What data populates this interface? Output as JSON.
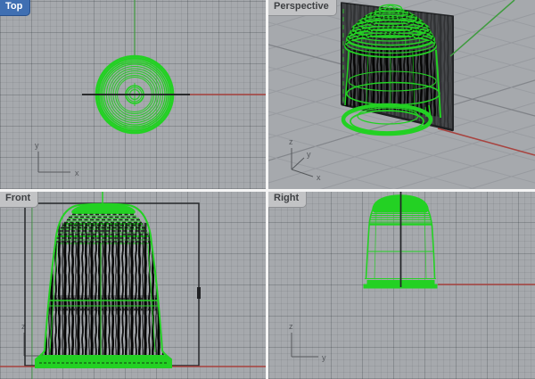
{
  "viewports": [
    {
      "id": "top",
      "label": "Top",
      "active": true,
      "axis_h": "x",
      "axis_v": "y"
    },
    {
      "id": "perspective",
      "label": "Perspective",
      "active": false,
      "axis_h": "x",
      "axis_v": "z",
      "axis_d": "y"
    },
    {
      "id": "front",
      "label": "Front",
      "active": false,
      "axis_v": "z"
    },
    {
      "id": "right",
      "label": "Right",
      "active": false,
      "axis_h": "y",
      "axis_v": "z"
    }
  ],
  "colors": {
    "viewport_bg": "#a6a9ad",
    "grid_minor": "rgba(50,56,64,0.09)",
    "grid_major": "rgba(35,40,46,0.16)",
    "object_green": "#23d123",
    "axis_red": "#a8433f",
    "axis_green": "#3f9b3f",
    "plane_fill": "#47494c",
    "plane_edge": "#232527",
    "texture_dark": "#0c0c0c",
    "tab_active_bg": "#3f6fb2",
    "tab_active_border": "#27508c",
    "tab_active_text": "#ffffff",
    "tab_bg": "#c2c3c5",
    "tab_border": "#8e9093",
    "tab_text": "#3e4043",
    "divider": "#f5f5f5",
    "icon_gray": "#55585c"
  }
}
